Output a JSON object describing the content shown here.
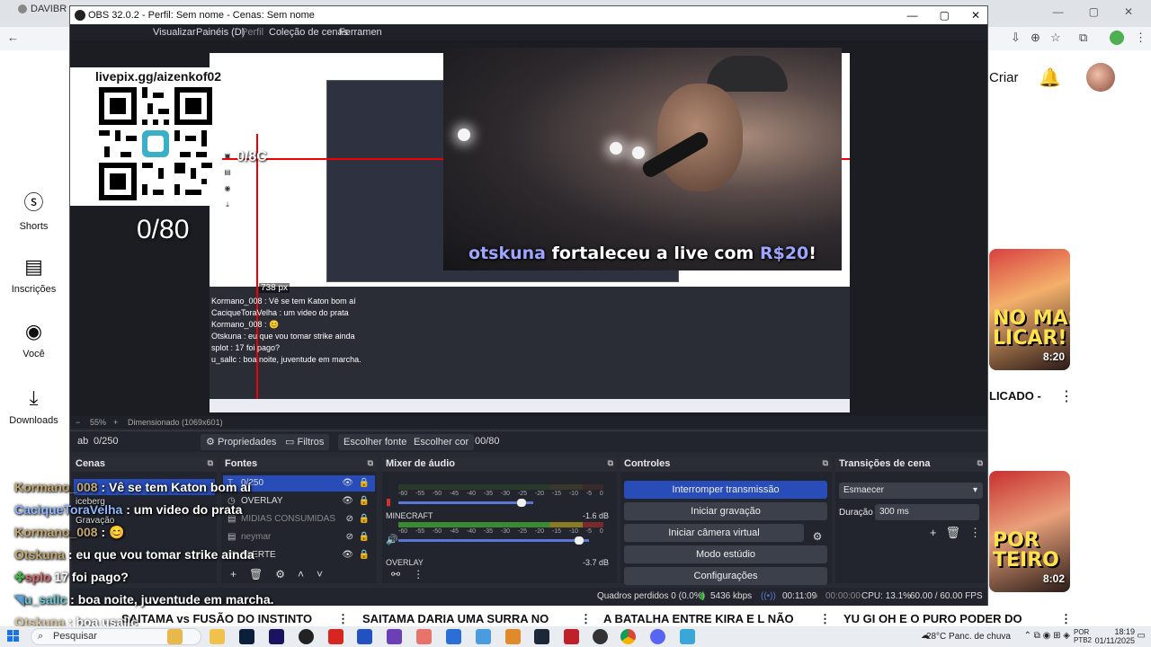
{
  "browser": {
    "tab_title": "DAVIBR",
    "tab_close": "✕",
    "window_controls": [
      "—",
      "▢",
      "✕"
    ]
  },
  "youtube": {
    "nav": [
      {
        "label": "Shorts",
        "icon": "shorts-icon"
      },
      {
        "label": "Inscrições",
        "icon": "subscriptions-icon"
      },
      {
        "label": "Você",
        "icon": "user-icon"
      },
      {
        "label": "Downloads",
        "icon": "download-icon"
      }
    ],
    "create_label": "Criar",
    "thumb1": {
      "big_text": "NO MAS\nLICAR!",
      "duration": "8:20",
      "title": "LICADO -"
    },
    "thumb2": {
      "big_text": "POR\nTEIRO",
      "duration": "8:02"
    },
    "bottom_videos": [
      "SAITAMA vs FUSÃO DO INSTINTO",
      "SAITAMA DARIA UMA SURRA NO",
      "A BATALHA ENTRE KIRA E L NÃO",
      "YU GI OH E O PURO PODER DO"
    ],
    "more_glyph": "⋮"
  },
  "obs": {
    "title": "OBS 32.0.2 - Perfil: Sem nome - Cenas: Sem nome",
    "window_controls": [
      "—",
      "▢",
      "✕"
    ],
    "menu": [
      "Visualizar",
      "Painéis (D)",
      "Perfil",
      "Coleção de cenas",
      "Ferramen"
    ],
    "qr_label": "livepix.gg/aizenkof02",
    "ratio_text": "0/80",
    "alert": {
      "user": "otskuna",
      "middle": " fortaleceu a live com ",
      "amount": "R$20",
      "end": "!"
    },
    "nested": {
      "ratio": "0/8C",
      "px": "738 px",
      "chat": [
        "Kormano_008 : Vê se tem Katon bom aí",
        "CaciqueToraVelha : um video do prata",
        "Kormano_008 : 😊",
        "Otskuna : eu que vou tomar strike ainda",
        "splot : 17 foi pago?",
        "u_sallc : boa noite, juventude em marcha."
      ]
    },
    "preview_status": {
      "zoom": "55%",
      "mode": "Dimensionado (1069x601)"
    },
    "toolbar": {
      "source_name": "0/250",
      "properties": "Propriedades",
      "filters": "Filtros",
      "choose_font": "Escolher fonte",
      "choose_color": "Escolher cor",
      "value": "00/80"
    },
    "docks": {
      "cenas": {
        "title": "Cenas",
        "items": [
          "Vê se tem Katon bom aí",
          "iceberg",
          "Gravação"
        ]
      },
      "fontes": {
        "title": "Fontes",
        "items": [
          {
            "label": "0/250",
            "type": "T"
          },
          {
            "label": "OVERLAY",
            "type": "◷"
          },
          {
            "label": "MIDIAS CONSUMIDAS",
            "type": "▤"
          },
          {
            "label": "neymar",
            "type": "▤"
          },
          {
            "label": "ALERTE",
            "type": "▤"
          }
        ]
      },
      "mixer": {
        "title": "Mixer de áudio",
        "scale": [
          "-60",
          "-55",
          "-50",
          "-45",
          "-40",
          "-35",
          "-30",
          "-25",
          "-20",
          "-15",
          "-10",
          "-5",
          "0"
        ],
        "channels": [
          {
            "name": "",
            "db": ""
          },
          {
            "name": "MINECRAFT",
            "db": "-1.6 dB"
          },
          {
            "name": "OVERLAY",
            "db": "-3.7 dB"
          }
        ]
      },
      "controles": {
        "title": "Controles",
        "buttons": [
          "Interromper transmissão",
          "Iniciar gravação",
          "Iniciar câmera virtual",
          "Modo estúdio",
          "Configurações"
        ]
      },
      "transicoes": {
        "title": "Transições de cena",
        "selected": "Esmaecer",
        "duration_label": "Duração",
        "duration_value": "300 ms"
      }
    },
    "status": {
      "frames": "Quadros perdidos 0 (0.0%)",
      "bitrate": "5436 kbps",
      "live_time": "00:11:09",
      "rec_time": "00:00:00",
      "cpu": "CPU: 13.1%",
      "fps": "60.00 / 60.00 FPS"
    }
  },
  "chat": [
    {
      "user": "Kormano_008",
      "msg": " : Vê se tem Katon bom aí"
    },
    {
      "user": "CaciqueToraVelha",
      "msg": " : um video do prata"
    },
    {
      "user": "Kormano_008",
      "msg": " : 😊"
    },
    {
      "user": "Otskuna",
      "msg": " : eu que vou tomar strike ainda"
    },
    {
      "user": "splo",
      "msg": " 17 foi pago?"
    },
    {
      "user": "u_sallc",
      "msg": " : boa noite, juventude em marcha."
    },
    {
      "user": "Otskuna",
      "msg": " : boa usallc"
    }
  ],
  "taskbar": {
    "search_placeholder": "Pesquisar",
    "weather": "28°C  Panc. de chuva",
    "lang": "POR\nPTB2",
    "time": "18:19",
    "date": "01/11/2025"
  },
  "colors": {
    "obs_bg": "#272a33",
    "obs_accent": "#284cb8",
    "alert_highlight": "#9da5ff"
  }
}
